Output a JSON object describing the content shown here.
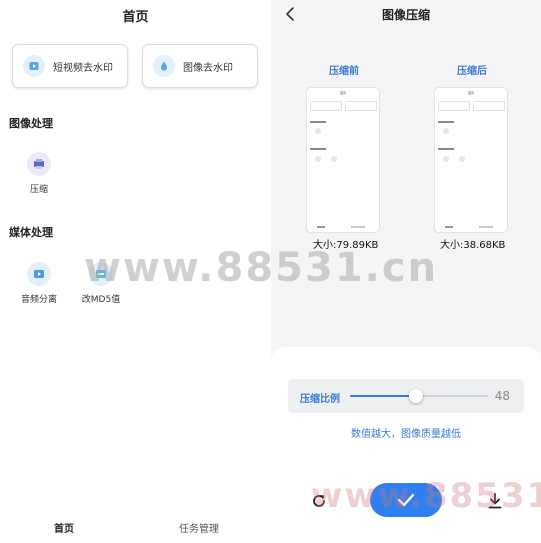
{
  "home": {
    "title": "首页",
    "features": [
      {
        "label": "短视频去水印",
        "icon": "video-watermark-icon"
      },
      {
        "label": "图像去水印",
        "icon": "image-watermark-icon"
      }
    ],
    "sections": [
      {
        "title": "图像处理",
        "tools": [
          {
            "label": "压缩",
            "icon": "compress-icon"
          }
        ]
      },
      {
        "title": "媒体处理",
        "tools": [
          {
            "label": "音频分离",
            "icon": "audio-separate-icon"
          },
          {
            "label": "改MD5值",
            "icon": "md5-icon"
          }
        ]
      }
    ],
    "nav": [
      {
        "label": "首页"
      },
      {
        "label": "任务管理"
      }
    ]
  },
  "compress": {
    "title": "图像压缩",
    "before_label": "压缩前",
    "after_label": "压缩后",
    "before_size": "大小:79.89KB",
    "after_size": "大小:38.68KB",
    "ratio_label": "压缩比例",
    "ratio_value": "48",
    "ratio_fraction": 0.48,
    "hint": "数值越大，图像质量越低"
  },
  "watermark": "www.88531.cn",
  "colors": {
    "accent": "#3a7bd5",
    "confirm": "#2f7ff0"
  }
}
